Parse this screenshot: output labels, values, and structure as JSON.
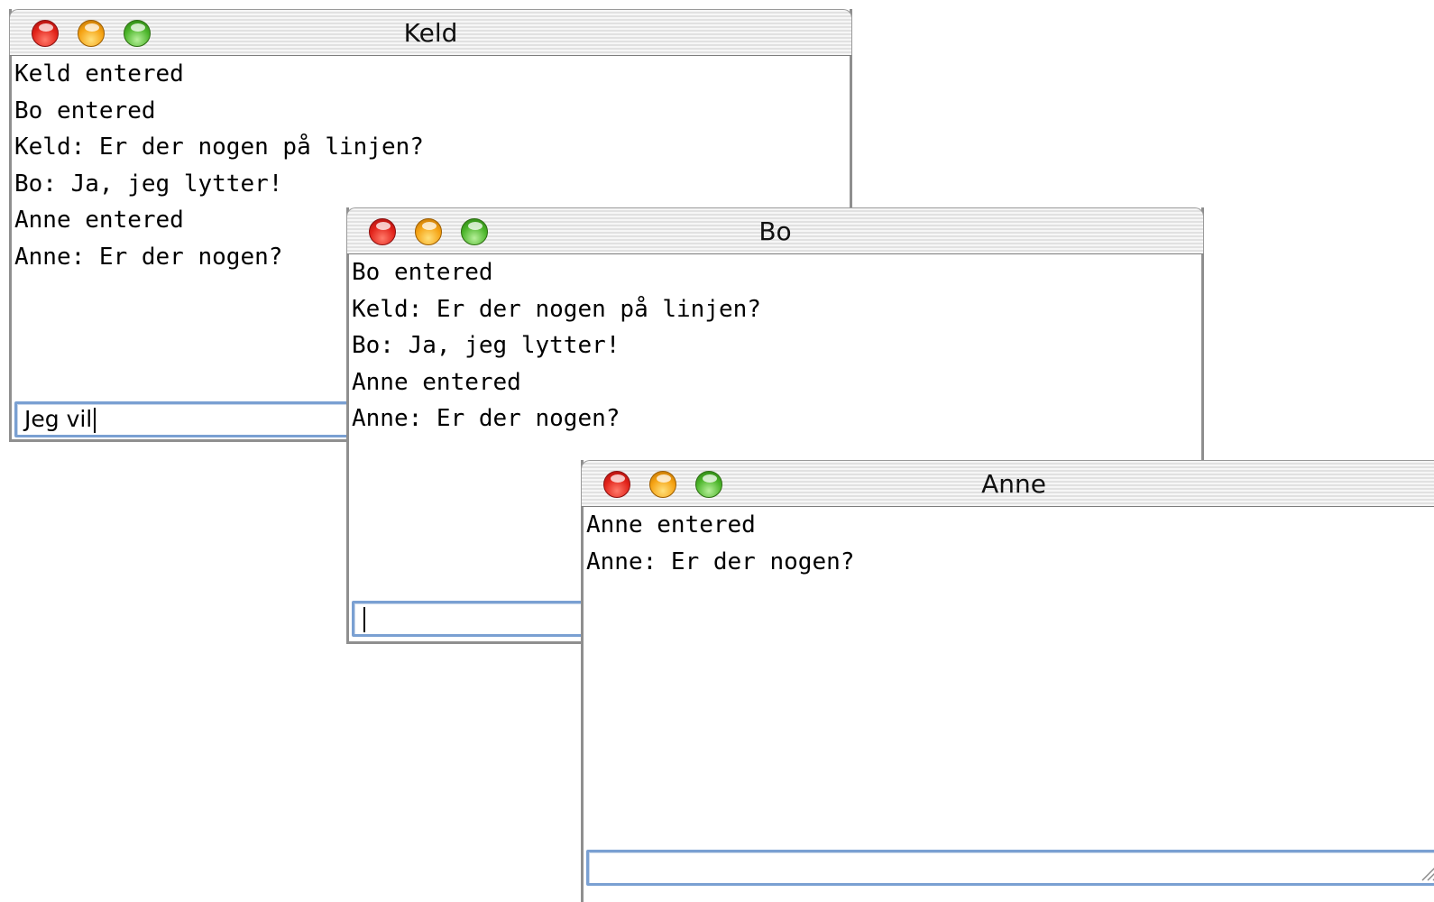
{
  "windows": {
    "keld": {
      "title": "Keld",
      "messages": [
        "Keld entered",
        "Bo entered",
        "Keld: Er der nogen på linjen?",
        "Bo: Ja, jeg lytter!",
        "Anne entered",
        "Anne: Er der nogen?"
      ],
      "input_value": "Jeg vil"
    },
    "bo": {
      "title": "Bo",
      "messages": [
        "Bo entered",
        "Keld: Er der nogen på linjen?",
        "Bo: Ja, jeg lytter!",
        "Anne entered",
        "Anne: Er der nogen?"
      ],
      "input_value": ""
    },
    "anne": {
      "title": "Anne",
      "messages": [
        "Anne entered",
        "Anne: Er der nogen?"
      ],
      "input_value": ""
    }
  },
  "icons": {
    "close": "close-button-icon",
    "minimize": "minimize-button-icon",
    "zoom": "zoom-button-icon",
    "resize": "resize-grip-icon"
  },
  "colors": {
    "close": "#e2231a",
    "minimize": "#f5a213",
    "zoom": "#4cb52b",
    "input_focus_border": "#7aa0d2"
  }
}
